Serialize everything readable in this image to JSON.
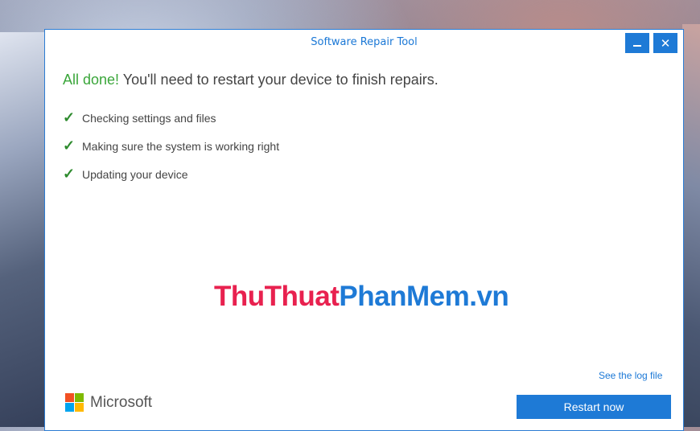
{
  "window": {
    "title": "Software Repair Tool",
    "minimize_symbol": "",
    "close_symbol": "✕"
  },
  "headline": {
    "status": "All done!",
    "message": "You'll need to restart your device to finish repairs."
  },
  "steps": [
    {
      "icon": "check-icon",
      "label": "Checking settings and files"
    },
    {
      "icon": "check-icon",
      "label": "Making sure the system is working right"
    },
    {
      "icon": "check-icon",
      "label": "Updating your device"
    }
  ],
  "check_glyph": "✓",
  "watermark": {
    "part1": "ThuThuat",
    "part2": "PhanMem.vn"
  },
  "footer": {
    "log_link": "See the log file",
    "brand": "Microsoft",
    "restart_button": "Restart now"
  },
  "colors": {
    "accent": "#1e7ad6",
    "success": "#3aa63a",
    "logo": [
      "#f25022",
      "#7fba00",
      "#00a4ef",
      "#ffb900"
    ]
  }
}
